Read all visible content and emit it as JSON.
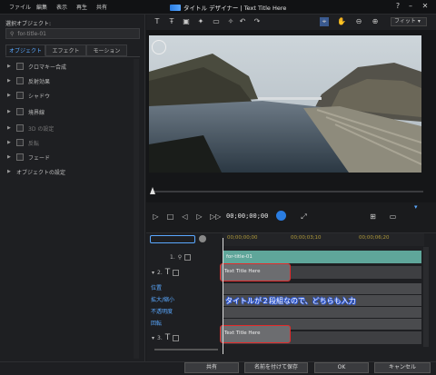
{
  "menu": [
    "ファイル",
    "編集",
    "表示",
    "再生",
    "共有"
  ],
  "app_title": "タイトル デザイナー | Text Title Here",
  "window_controls": {
    "help": "?",
    "minimize": "–",
    "close": "✕"
  },
  "left_panel": {
    "selected_object_label": "選択オブジェクト:",
    "selected_object_value": "for-title-01",
    "tabs": [
      "オブジェクト",
      "エフェクト",
      "モーション"
    ],
    "properties": [
      {
        "label": "クロマキー合成",
        "enabled": true
      },
      {
        "label": "反射効果",
        "enabled": true
      },
      {
        "label": "シャドウ",
        "enabled": true
      },
      {
        "label": "境界線",
        "enabled": true
      },
      {
        "label": "3D の設定",
        "enabled": false
      },
      {
        "label": "反転",
        "enabled": false
      },
      {
        "label": "フェード",
        "enabled": true
      }
    ],
    "object_settings": "オブジェクトの設定"
  },
  "toolbar": {
    "fit_label": "フィット"
  },
  "player": {
    "timecode": "00;00;00;00"
  },
  "timeline": {
    "ruler": [
      "00;00;00;00",
      "00;00;03;10",
      "00;00;06;20"
    ],
    "rows": [
      {
        "index": "1.",
        "clip": "for-title-01"
      },
      {
        "index": "2.",
        "clip": "Text Title Here"
      },
      {
        "index": "3.",
        "clip": "Text Title Here"
      }
    ],
    "sub_tracks": [
      "位置",
      "拡大/縮小",
      "不透明度",
      "回転"
    ],
    "annotation": "タイトルが２段組なので、どちらも入力"
  },
  "bottom_buttons": {
    "share": "共有",
    "save_as": "名前を付けて保存",
    "ok": "OK",
    "cancel": "キャンセル"
  },
  "colors": {
    "accent": "#2a7de1",
    "highlight": "#e32b2b",
    "track_clip": "#6c6d70",
    "title_clip": "#5fa69a"
  }
}
